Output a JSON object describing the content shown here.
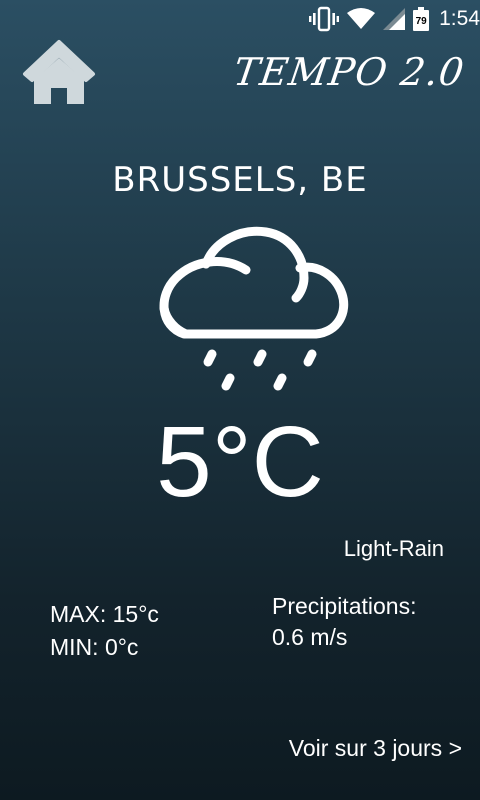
{
  "status_bar": {
    "time": "1:54",
    "battery_level": "79",
    "icons": [
      "vibrate-icon",
      "wifi-icon",
      "cell-signal-icon",
      "battery-icon"
    ]
  },
  "header": {
    "home_icon": "home-icon",
    "app_title": "TEMPO 2.0"
  },
  "weather": {
    "city": "BRUSSELS, BE",
    "icon": "cloud-rain-icon",
    "temperature": "5°C",
    "condition": "Light-Rain",
    "max": "MAX: 15°c",
    "min": "MIN: 0°c",
    "precip_label": "Precipitations:",
    "precip_value": "0.6 m/s"
  },
  "footer": {
    "forecast_link": "Voir sur 3 jours >"
  },
  "colors": {
    "background_top": "#2b4f63",
    "background_bottom": "#0d1a21",
    "icon_fill": "#cfd8dc",
    "text": "#ffffff"
  }
}
